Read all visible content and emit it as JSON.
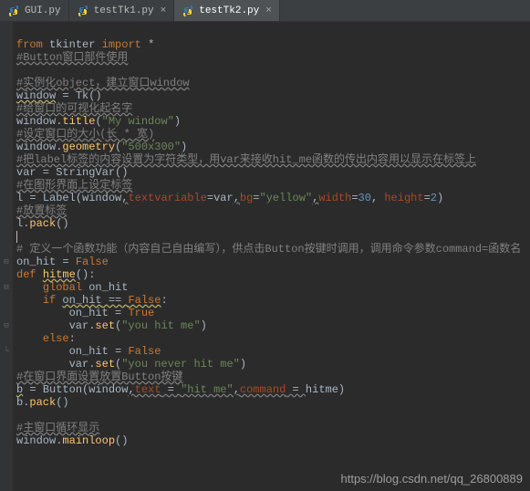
{
  "tabs": [
    {
      "label": "GUI.py",
      "active": false
    },
    {
      "label": "testTk1.py",
      "active": false
    },
    {
      "label": "testTk2.py",
      "active": true
    }
  ],
  "code": {
    "l1_from": "from",
    "l1_mod": "tkinter",
    "l1_import": "import",
    "l1_star": "*",
    "l2": "#Button窗口部件使用",
    "l3": "#实例化object，建立窗口window",
    "l4_var": "window",
    "l4_eq": " = ",
    "l4_fn": "Tk",
    "l4_p": "()",
    "l5": "#给窗口的可视化起名字",
    "l6_obj": "window.",
    "l6_fn": "title",
    "l6_p1": "(",
    "l6_str": "\"My window\"",
    "l6_p2": ")",
    "l7": "#设定窗口的大小(长 * 宽)",
    "l8_obj": "window.",
    "l8_fn": "geometry",
    "l8_p1": "(",
    "l8_str": "\"500x300\"",
    "l8_p2": ")",
    "l9": "#把label标签的内容设置为字符类型，用var来接收hit_me函数的传出内容用以显示在标签上",
    "l10_var": "var",
    "l10_eq": " = ",
    "l10_fn": "StringVar",
    "l10_p": "()",
    "l11": "#在图形界面上设定标签",
    "l12_var": "l",
    "l12_eq": " = ",
    "l12_fn": "Label",
    "l12_p1": "(window",
    "l12_c1": ",",
    "l12_kw1": "textvariable",
    "l12_v1": "=var",
    "l12_c2": ",",
    "l12_kw2": "bg",
    "l12_eq2": "=",
    "l12_str": "\"yellow\"",
    "l12_c3": ",",
    "l12_kw3": "width",
    "l12_eq3": "=",
    "l12_num1": "30",
    "l12_op": ", ",
    "l12_kw4": "height",
    "l12_eq4": "=",
    "l12_num2": "2",
    "l12_p2": ")",
    "l13": "#放置标签",
    "l14_obj": "l.",
    "l14_fn": "pack",
    "l14_p": "()",
    "l16": "# 定义一个函数功能（内容自己自由编写），供点击Button按键时调用，调用命令参数command=函数名",
    "l17_var": "on_hit",
    "l17_eq": " = ",
    "l17_val": "False",
    "l18_def": "def ",
    "l18_fn": "hitme",
    "l18_p": "():",
    "l19_kw": "global ",
    "l19_var": "on_hit",
    "l20_if": "if ",
    "l20_var": "on_hit",
    "l20_eq": " == ",
    "l20_val": "False",
    "l20_c": ":",
    "l21_var": "on_hit",
    "l21_eq": " = ",
    "l21_val": "True",
    "l22_obj": "var.",
    "l22_fn": "set",
    "l22_p1": "(",
    "l22_str": "\"you hit me\"",
    "l22_p2": ")",
    "l23_else": "else",
    "l23_c": ":",
    "l24_var": "on_hit",
    "l24_eq": " = ",
    "l24_val": "False",
    "l25_obj": "var.",
    "l25_fn": "set",
    "l25_p1": "(",
    "l25_str": "\"you never hit me\"",
    "l25_p2": ")",
    "l26": "#在窗口界面设置放置Button按键",
    "l27_var": "b",
    "l27_eq": " = ",
    "l27_fn": "Button",
    "l27_p1": "(window",
    "l27_c1": ",",
    "l27_kw1": "text",
    "l27_eq1": " = ",
    "l27_str": "\"hit me\"",
    "l27_c2": ",",
    "l27_kw2": "command",
    "l27_eq2": " = ",
    "l27_v2": "hitme)",
    "l28_obj": "b.",
    "l28_fn": "pack",
    "l28_p": "()",
    "l30": "#主窗口循环显示",
    "l31_obj": "window.",
    "l31_fn": "mainloop",
    "l31_p": "()"
  },
  "watermark": "https://blog.csdn.net/qq_26800889"
}
